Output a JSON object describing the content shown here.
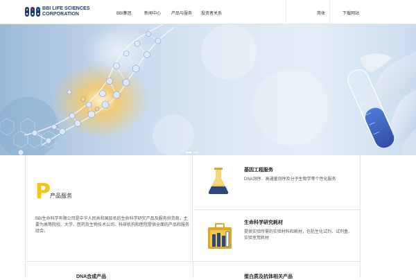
{
  "header": {
    "logo_line1": "BBI LIFE SCIENCES",
    "logo_line2": "CORPORATION",
    "nav": [
      "BBI集团",
      "新闻中心",
      "产品与服务",
      "投资者关系"
    ],
    "right_nav": [
      "简体",
      "下载网站"
    ]
  },
  "hero": {
    "slides": 2,
    "active_slide": 0
  },
  "products": {
    "letter": "P",
    "title": "产品服务",
    "description": "BBI生命科学有限公司是中华人民共和国知名的生命科学研究产品及服务供货商。主要为高等院校、大学、医药及生物技术公司、科研机构和医院提供全面的产品和服务组合。"
  },
  "cards": [
    {
      "title": "基因工程服务",
      "description": "DNA测序、高通量测序及分子生物学等个性化服务"
    },
    {
      "title": "生命科学研究耗材",
      "description": "提供实验所需的实验材料和耗材，包括生化试剂、试剂盒、实验室用耗材"
    }
  ],
  "bottom": {
    "left_title": "DNA合成产品",
    "right_title": "蛋白质及抗体相关产品"
  },
  "colors": {
    "brand_blue": "#1d3a7a",
    "accent_yellow": "#f6c418",
    "icon_gold": "#d9a826",
    "icon_navy": "#2c4a78"
  }
}
